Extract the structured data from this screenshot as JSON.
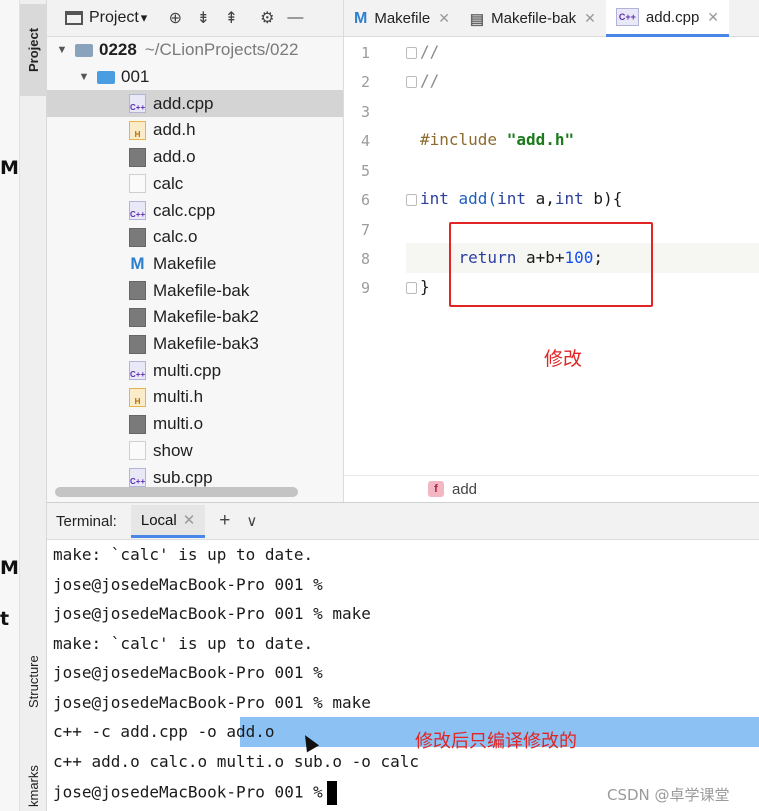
{
  "left_strip_fragments": [
    "M",
    "M",
    "t"
  ],
  "stripe_tabs": {
    "project": "Project",
    "structure": "Structure",
    "bookmarks": "kmarks"
  },
  "project_header": {
    "title": "Project",
    "dropdown_glyph": "▾"
  },
  "tree": {
    "root": {
      "name": "0228",
      "path": "~/CLionProjects/022"
    },
    "folder": {
      "name": "001"
    },
    "files": [
      {
        "name": "add.cpp",
        "type": "cpp",
        "selected": true
      },
      {
        "name": "add.h",
        "type": "h"
      },
      {
        "name": "add.o",
        "type": "bin"
      },
      {
        "name": "calc",
        "type": "txt"
      },
      {
        "name": "calc.cpp",
        "type": "cpp"
      },
      {
        "name": "calc.o",
        "type": "bin"
      },
      {
        "name": "Makefile",
        "type": "mk"
      },
      {
        "name": "Makefile-bak",
        "type": "bin"
      },
      {
        "name": "Makefile-bak2",
        "type": "bin"
      },
      {
        "name": "Makefile-bak3",
        "type": "bin"
      },
      {
        "name": "multi.cpp",
        "type": "cpp"
      },
      {
        "name": "multi.h",
        "type": "h"
      },
      {
        "name": "multi.o",
        "type": "bin"
      },
      {
        "name": "show",
        "type": "txt"
      },
      {
        "name": "sub.cpp",
        "type": "cpp"
      }
    ]
  },
  "editor_tabs": [
    {
      "label": "Makefile",
      "icon": "M",
      "active": false
    },
    {
      "label": "Makefile-bak",
      "icon": "▤",
      "active": false
    },
    {
      "label": "add.cpp",
      "icon": "C++",
      "active": true
    }
  ],
  "code": {
    "line_numbers": [
      "1",
      "2",
      "3",
      "4",
      "5",
      "6",
      "7",
      "8",
      "9"
    ],
    "l1": "//",
    "l2": "//",
    "l4_directive": "#include",
    "l4_string": "\"add.h\"",
    "l6": {
      "kw1": "int",
      "fn": " add(",
      "kw2": "int",
      "mid": " a,",
      "kw3": "int",
      "end": " b){"
    },
    "l8": {
      "indent": "    ",
      "kw": "return",
      "expr": " a+b+",
      "num": "100",
      "tail": ";"
    },
    "l9": "}",
    "annotation": "修改",
    "breadcrumb_badge": "f",
    "breadcrumb": "add"
  },
  "terminal": {
    "title": "Terminal:",
    "tab_label": "Local",
    "lines": [
      "make: `calc' is up to date.",
      "jose@josedeMacBook-Pro 001 %",
      "jose@josedeMacBook-Pro 001 % make",
      "make: `calc' is up to date.",
      "jose@josedeMacBook-Pro 001 %",
      "jose@josedeMacBook-Pro 001 % make"
    ],
    "line7": "c++ -c add.cpp -o add.o",
    "line8": "c++ add.o calc.o multi.o sub.o -o calc",
    "prompt": "jose@josedeMacBook-Pro 001 %",
    "annotation": "修改后只编译修改的"
  },
  "watermark": "CSDN @卓学课堂",
  "colors": {
    "accent": "#4a86e8",
    "annotation_red": "#e22424",
    "selection": "#8cc1f3"
  }
}
